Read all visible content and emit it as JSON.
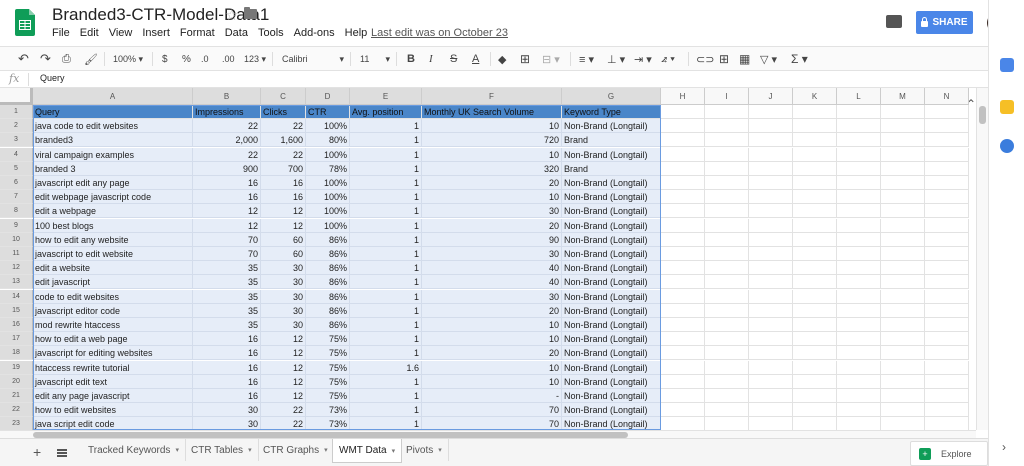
{
  "doc": {
    "title": "Branded3-CTR-Model-Data1",
    "last_edit": "Last edit was on October 23"
  },
  "menu": [
    "File",
    "Edit",
    "View",
    "Insert",
    "Format",
    "Data",
    "Tools",
    "Add-ons",
    "Help"
  ],
  "share_label": "SHARE",
  "toolbar": {
    "zoom": "100%",
    "currency": "$",
    "percent": "%",
    "dec_dec": ".0",
    "dec_inc": ".00",
    "format_more": "123",
    "font": "Calibri",
    "size": "11"
  },
  "formula": {
    "fx": "fx",
    "value": "Query"
  },
  "columns": [
    "A",
    "B",
    "C",
    "D",
    "E",
    "F",
    "G",
    "H",
    "I",
    "J",
    "K",
    "L",
    "M",
    "N"
  ],
  "header_row": [
    "Query",
    "Impressions",
    "Clicks",
    "CTR",
    "Avg. position",
    "Monthly UK Search Volume",
    "Keyword Type"
  ],
  "rows": [
    [
      "java code to edit websites",
      "22",
      "22",
      "100%",
      "1",
      "10",
      "Non-Brand (Longtail)"
    ],
    [
      "branded3",
      "2,000",
      "1,600",
      "80%",
      "1",
      "720",
      "Brand"
    ],
    [
      "viral campaign examples",
      "22",
      "22",
      "100%",
      "1",
      "10",
      "Non-Brand (Longtail)"
    ],
    [
      "branded 3",
      "900",
      "700",
      "78%",
      "1",
      "320",
      "Brand"
    ],
    [
      "javascript edit any page",
      "16",
      "16",
      "100%",
      "1",
      "20",
      "Non-Brand (Longtail)"
    ],
    [
      "edit webpage javascript code",
      "16",
      "16",
      "100%",
      "1",
      "10",
      "Non-Brand (Longtail)"
    ],
    [
      "edit a webpage",
      "12",
      "12",
      "100%",
      "1",
      "30",
      "Non-Brand (Longtail)"
    ],
    [
      "100 best blogs",
      "12",
      "12",
      "100%",
      "1",
      "20",
      "Non-Brand (Longtail)"
    ],
    [
      "how to edit any website",
      "70",
      "60",
      "86%",
      "1",
      "90",
      "Non-Brand (Longtail)"
    ],
    [
      "javascript to edit website",
      "70",
      "60",
      "86%",
      "1",
      "30",
      "Non-Brand (Longtail)"
    ],
    [
      "edit a website",
      "35",
      "30",
      "86%",
      "1",
      "40",
      "Non-Brand (Longtail)"
    ],
    [
      "edit javascript",
      "35",
      "30",
      "86%",
      "1",
      "40",
      "Non-Brand (Longtail)"
    ],
    [
      "code to edit websites",
      "35",
      "30",
      "86%",
      "1",
      "30",
      "Non-Brand (Longtail)"
    ],
    [
      "javascript editor code",
      "35",
      "30",
      "86%",
      "1",
      "20",
      "Non-Brand (Longtail)"
    ],
    [
      "mod rewrite htaccess",
      "35",
      "30",
      "86%",
      "1",
      "10",
      "Non-Brand (Longtail)"
    ],
    [
      "how to edit a web page",
      "16",
      "12",
      "75%",
      "1",
      "10",
      "Non-Brand (Longtail)"
    ],
    [
      "javascript for editing websites",
      "16",
      "12",
      "75%",
      "1",
      "20",
      "Non-Brand (Longtail)"
    ],
    [
      "htaccess rewrite tutorial",
      "16",
      "12",
      "75%",
      "1.6",
      "10",
      "Non-Brand (Longtail)"
    ],
    [
      "javascript edit text",
      "16",
      "12",
      "75%",
      "1",
      "10",
      "Non-Brand (Longtail)"
    ],
    [
      "edit any page javascript",
      "16",
      "12",
      "75%",
      "1",
      "-",
      "Non-Brand (Longtail)"
    ],
    [
      "how to edit websites",
      "30",
      "22",
      "73%",
      "1",
      "70",
      "Non-Brand (Longtail)"
    ],
    [
      "java script edit code",
      "30",
      "22",
      "73%",
      "1",
      "70",
      "Non-Brand (Longtail)"
    ]
  ],
  "sheets": [
    "Tracked Keywords",
    "CTR Tables",
    "CTR Graphs",
    "WMT Data",
    "Pivots"
  ],
  "active_sheet": "WMT Data",
  "explore_label": "Explore",
  "colors": {
    "share": "#4a86e8",
    "header_fill": "#4a86c9",
    "selection": "#e6edf8"
  }
}
